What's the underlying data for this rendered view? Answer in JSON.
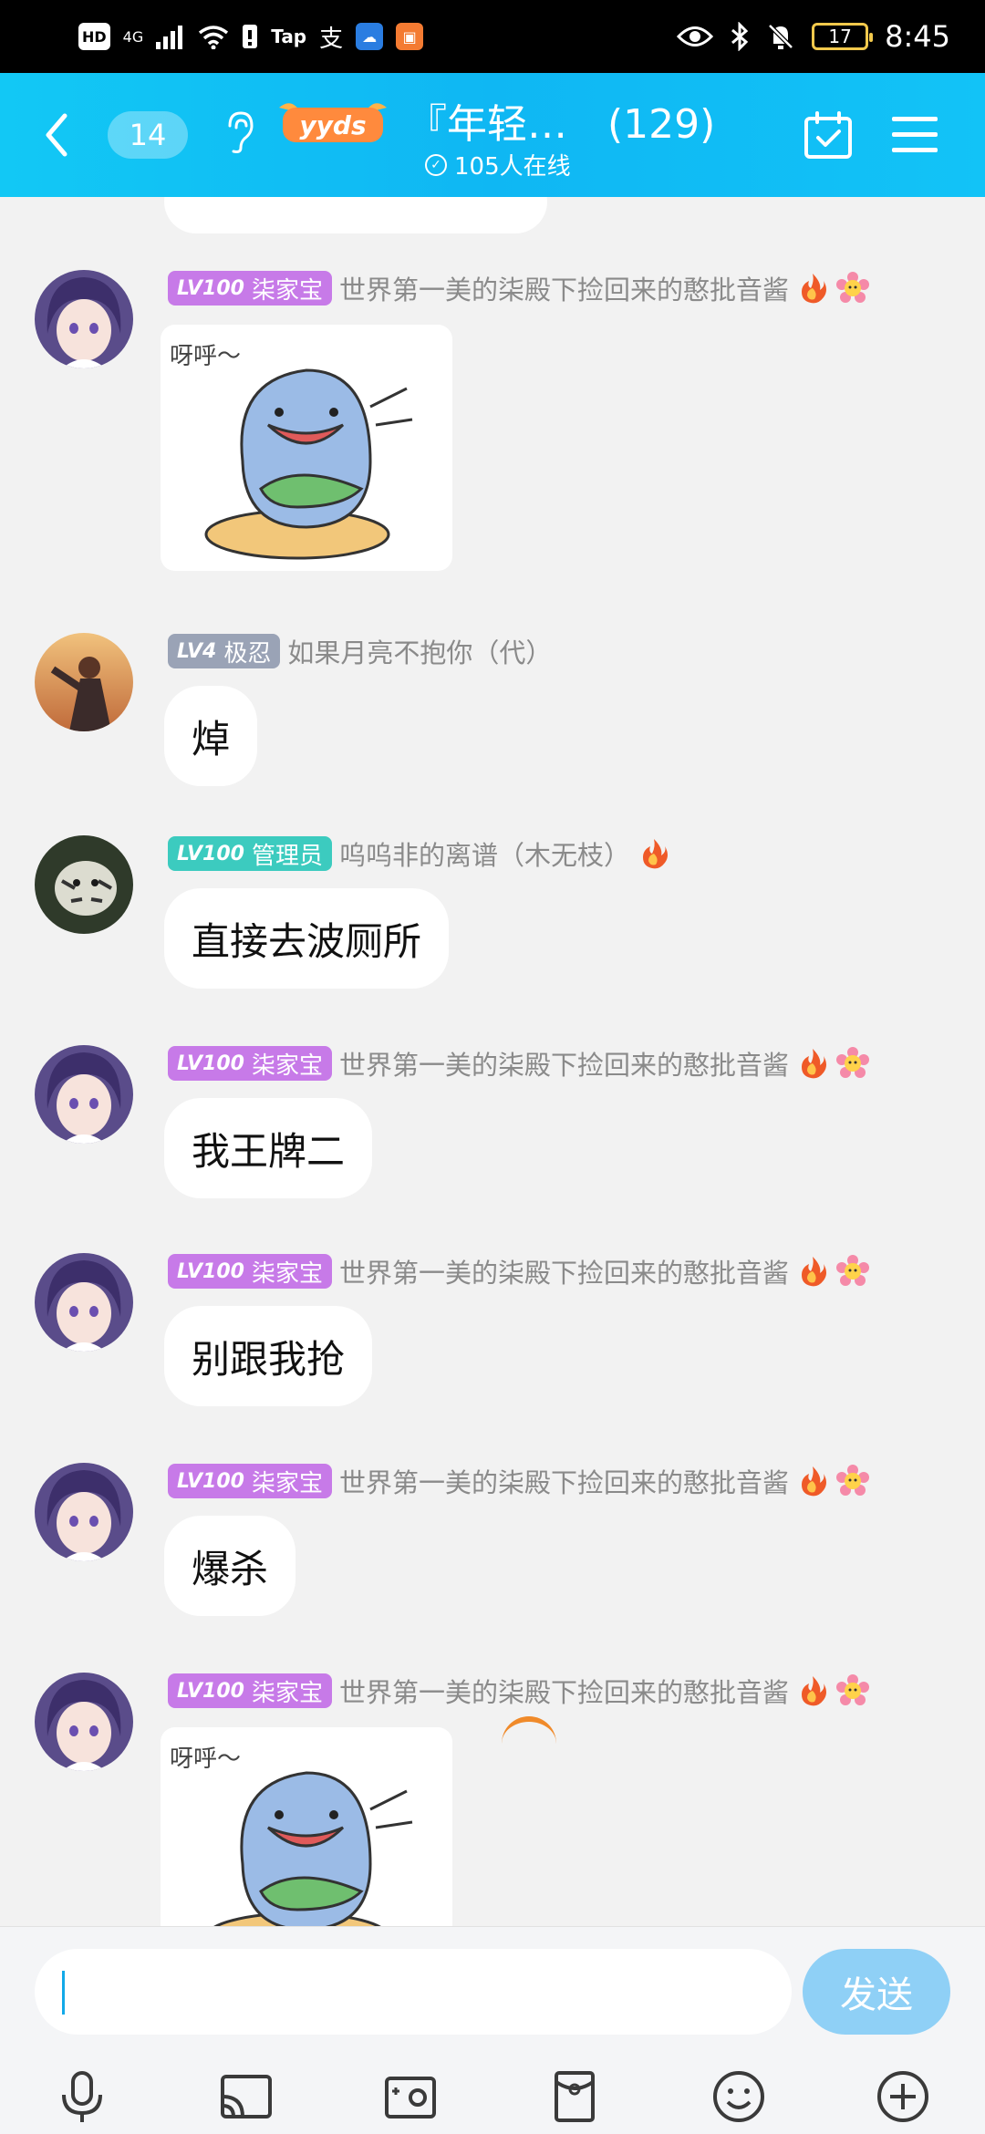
{
  "status_bar": {
    "left_icons": [
      "HD",
      "4G",
      "signal-icon",
      "wifi-icon",
      "alert-icon",
      "Tap",
      "支",
      "weather-app-icon",
      "game-app-icon"
    ],
    "battery": "17",
    "time": "8:45"
  },
  "header": {
    "unread_count": "14",
    "title": "『年轻…　(129)",
    "online": "105人在线",
    "badge": "yyds"
  },
  "messages": [
    {
      "level": "LV100",
      "title_label": "柒家宝",
      "title_color": "#c77ae8",
      "nickname": "世界第一美的柒殿下捡回来的憨批音酱",
      "flame": true,
      "flower": true,
      "type": "sticker",
      "sticker_text": "呀呼～",
      "avatar": "purple-hair"
    },
    {
      "level": "LV4",
      "title_label": "极忍",
      "title_color": "#9aa3b6",
      "nickname": "如果月亮不抱你（代）",
      "flame": false,
      "flower": false,
      "type": "text",
      "text": "焯",
      "avatar": "sunset-boy"
    },
    {
      "level": "LV100",
      "title_label": "管理员",
      "title_color": "#3ccbbf",
      "nickname": "呜呜非的离谱（木无枝）",
      "flame": true,
      "flower": false,
      "type": "text",
      "text": "直接去波厕所",
      "avatar": "tiger"
    },
    {
      "level": "LV100",
      "title_label": "柒家宝",
      "title_color": "#c77ae8",
      "nickname": "世界第一美的柒殿下捡回来的憨批音酱",
      "flame": true,
      "flower": true,
      "type": "text",
      "text": "我王牌二",
      "avatar": "purple-hair"
    },
    {
      "level": "LV100",
      "title_label": "柒家宝",
      "title_color": "#c77ae8",
      "nickname": "世界第一美的柒殿下捡回来的憨批音酱",
      "flame": true,
      "flower": true,
      "type": "text",
      "text": "别跟我抢",
      "avatar": "purple-hair"
    },
    {
      "level": "LV100",
      "title_label": "柒家宝",
      "title_color": "#c77ae8",
      "nickname": "世界第一美的柒殿下捡回来的憨批音酱",
      "flame": true,
      "flower": true,
      "type": "text",
      "text": "爆杀",
      "avatar": "purple-hair"
    },
    {
      "level": "LV100",
      "title_label": "柒家宝",
      "title_color": "#c77ae8",
      "nickname": "世界第一美的柒殿下捡回来的憨批音酱",
      "flame": true,
      "flower": true,
      "type": "sticker",
      "sticker_text": "呀呼～",
      "avatar": "purple-hair"
    }
  ],
  "composer": {
    "input_value": "",
    "send_label": "发送"
  },
  "toolbar": [
    "microphone-icon",
    "screen-cast-icon",
    "photo-icon",
    "red-packet-icon",
    "emoji-icon",
    "more-plus-icon"
  ],
  "colors": {
    "accent": "#12c3f7",
    "send": "#8fd0f6",
    "background": "#f2f2f2"
  }
}
